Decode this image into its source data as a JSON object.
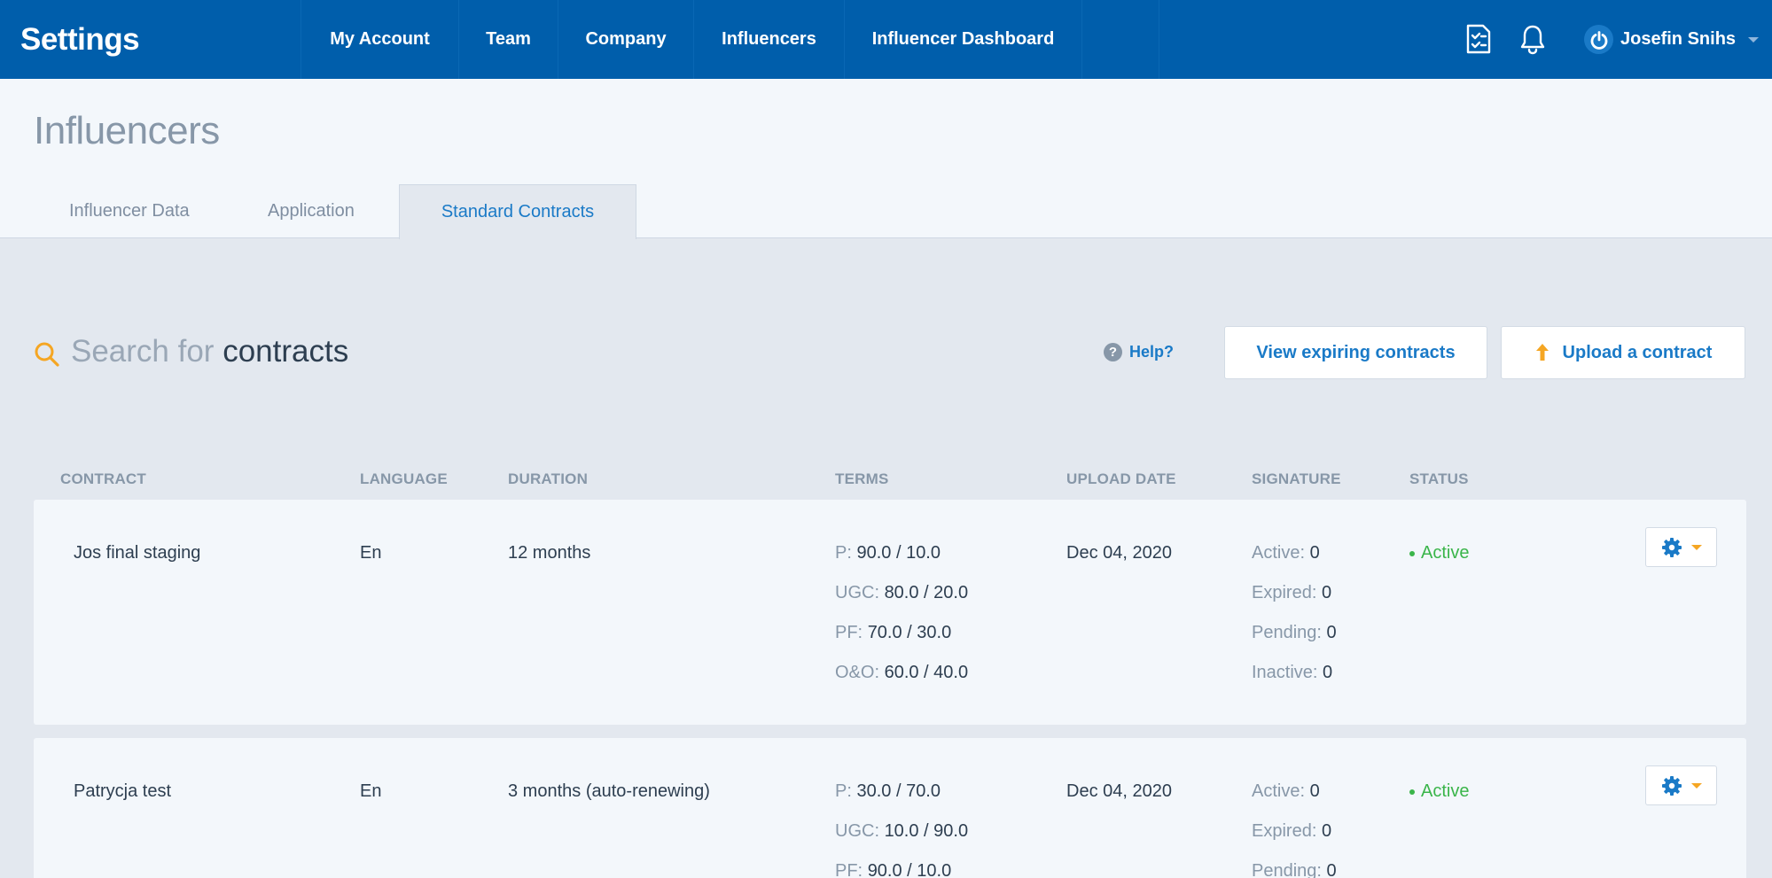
{
  "app": {
    "title": "Settings"
  },
  "nav": [
    {
      "label": "My Account"
    },
    {
      "label": "Team"
    },
    {
      "label": "Company"
    },
    {
      "label": "Influencers"
    },
    {
      "label": "Influencer Dashboard"
    }
  ],
  "topbar": {
    "icons": [
      "checklist-icon",
      "bell-icon"
    ],
    "user": {
      "name": "Josefin Snihs",
      "avatar_icon": "power-icon"
    }
  },
  "page": {
    "title": "Influencers",
    "tabs": [
      {
        "label": "Influencer Data",
        "active": false
      },
      {
        "label": "Application",
        "active": false
      },
      {
        "label": "Standard Contracts",
        "active": true
      }
    ]
  },
  "search": {
    "placeholder": "Search for",
    "keyword": "contracts",
    "icon": "search-icon"
  },
  "actions": {
    "help_label": "Help?",
    "help_icon": "?",
    "view_expiring_label": "View expiring contracts",
    "upload_label": "Upload a contract",
    "upload_icon": "arrow-up-icon"
  },
  "table": {
    "columns": [
      "CONTRACT",
      "LANGUAGE",
      "DURATION",
      "TERMS",
      "UPLOAD DATE",
      "SIGNATURE",
      "STATUS"
    ],
    "rows": [
      {
        "contract": "Jos final staging",
        "language": "En",
        "duration": "12 months",
        "terms": [
          {
            "k": "P:",
            "v": "90.0 / 10.0"
          },
          {
            "k": "UGC:",
            "v": "80.0 / 20.0"
          },
          {
            "k": "PF:",
            "v": "70.0 / 30.0"
          },
          {
            "k": "O&O:",
            "v": "60.0 / 40.0"
          }
        ],
        "upload_date": "Dec 04, 2020",
        "signature": [
          {
            "k": "Active:",
            "v": "0"
          },
          {
            "k": "Expired:",
            "v": "0"
          },
          {
            "k": "Pending:",
            "v": "0"
          },
          {
            "k": "Inactive:",
            "v": "0"
          }
        ],
        "status": "Active"
      },
      {
        "contract": "Patrycja test",
        "language": "En",
        "duration": "3 months (auto-renewing)",
        "terms": [
          {
            "k": "P:",
            "v": "30.0 / 70.0"
          },
          {
            "k": "UGC:",
            "v": "10.0 / 90.0"
          },
          {
            "k": "PF:",
            "v": "90.0 / 10.0"
          }
        ],
        "upload_date": "Dec 04, 2020",
        "signature": [
          {
            "k": "Active:",
            "v": "0"
          },
          {
            "k": "Expired:",
            "v": "0"
          },
          {
            "k": "Pending:",
            "v": "0"
          }
        ],
        "status": "Active"
      }
    ]
  },
  "colors": {
    "topbar": "#005eab",
    "accent": "#1a7ac7",
    "status_active": "#3ab54a",
    "warning": "#f5a623"
  }
}
